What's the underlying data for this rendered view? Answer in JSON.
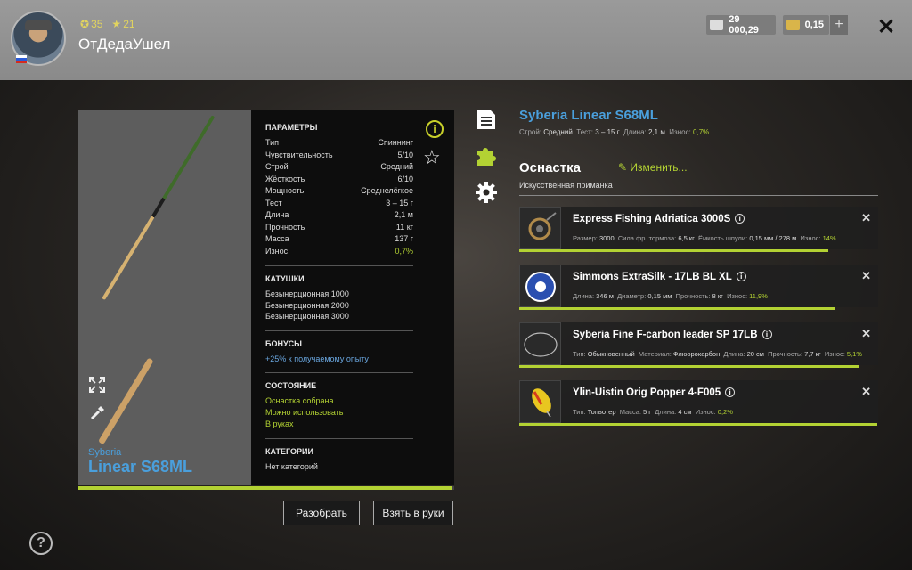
{
  "player": {
    "name": "ОтДедаУшел",
    "level": "35",
    "rank": "21"
  },
  "currency": {
    "silver": "29 000,29",
    "gold": "0,15"
  },
  "rod": {
    "brand": "Syberia",
    "name": "Linear S68ML",
    "wear_progress": 0.993
  },
  "params": {
    "title": "ПАРАМЕТРЫ",
    "rows": [
      {
        "label": "Тип",
        "value": "Спиннинг"
      },
      {
        "label": "Чувствительность",
        "value": "5/10"
      },
      {
        "label": "Строй",
        "value": "Средний"
      },
      {
        "label": "Жёсткость",
        "value": "6/10"
      },
      {
        "label": "Мощность",
        "value": "Среднелёгкое"
      },
      {
        "label": "Тест",
        "value": "3 – 15 г"
      },
      {
        "label": "Длина",
        "value": "2,1 м"
      },
      {
        "label": "Прочность",
        "value": "11 кг"
      },
      {
        "label": "Масса",
        "value": "137 г"
      },
      {
        "label": "Износ",
        "value": "0,7%"
      }
    ],
    "reels_title": "КАТУШКИ",
    "reels": [
      "Безынерционная 1000",
      "Безынерционная 2000",
      "Безынерционная 3000"
    ],
    "bonus_title": "БОНУСЫ",
    "bonus": "+25% к получаемому опыту",
    "state_title": "СОСТОЯНИЕ",
    "state": [
      "Оснастка собрана",
      "Можно использовать",
      "В руках"
    ],
    "cat_title": "КАТЕГОРИИ",
    "cat": "Нет категорий"
  },
  "buttons": {
    "disassemble": "Разобрать",
    "take": "Взять в руки"
  },
  "right": {
    "title": "Syberia Linear S68ML",
    "sub": {
      "action_label": "Строй:",
      "action": "Средний",
      "test_label": "Тест:",
      "test": "3 – 15 г",
      "length_label": "Длина:",
      "length": "2,1 м",
      "wear_label": "Износ:",
      "wear": "0,7%"
    },
    "section": "Оснастка",
    "edit": "Изменить...",
    "lure_type": "Искусственная приманка"
  },
  "tackle": [
    {
      "name": "Express Fishing Adriatica 3000S",
      "stats": [
        {
          "label": "Размер:",
          "value": "3000"
        },
        {
          "label": "Сила фр. тормоза:",
          "value": "6,5 кг"
        },
        {
          "label": "Ёмкость шпули:",
          "value": "0,15 мм / 278 м"
        },
        {
          "label": "Износ:",
          "value": "14%",
          "green": true
        }
      ],
      "progress": 0.86,
      "icon": "reel-icon"
    },
    {
      "name": "Simmons ExtraSilk - 17LB BL XL",
      "stats": [
        {
          "label": "Длина:",
          "value": "346 м"
        },
        {
          "label": "Диаметр:",
          "value": "0,15 мм"
        },
        {
          "label": "Прочность:",
          "value": "8 кг"
        },
        {
          "label": "Износ:",
          "value": "11,9%",
          "green": true
        }
      ],
      "progress": 0.881,
      "icon": "line-spool-icon"
    },
    {
      "name": "Syberia Fine F-carbon leader SP 17LB",
      "stats": [
        {
          "label": "Тип:",
          "value": "Обыкновенный"
        },
        {
          "label": "Материал:",
          "value": "Флюорокарбон"
        },
        {
          "label": "Длина:",
          "value": "20 см"
        },
        {
          "label": "Прочность:",
          "value": "7,7 кг"
        },
        {
          "label": "Износ:",
          "value": "5,1%",
          "green": true
        }
      ],
      "progress": 0.949,
      "icon": "leader-icon"
    },
    {
      "name": "Ylin-Uistin Orig Popper 4-F005",
      "stats": [
        {
          "label": "Тип:",
          "value": "Топвотер"
        },
        {
          "label": "Масса:",
          "value": "5 г"
        },
        {
          "label": "Длина:",
          "value": "4 см"
        },
        {
          "label": "Износ:",
          "value": "0,2%",
          "green": true
        }
      ],
      "progress": 0.998,
      "icon": "popper-lure-icon"
    }
  ],
  "colors": {
    "accent_green": "#b3d233",
    "accent_blue": "#4a9fdc"
  }
}
